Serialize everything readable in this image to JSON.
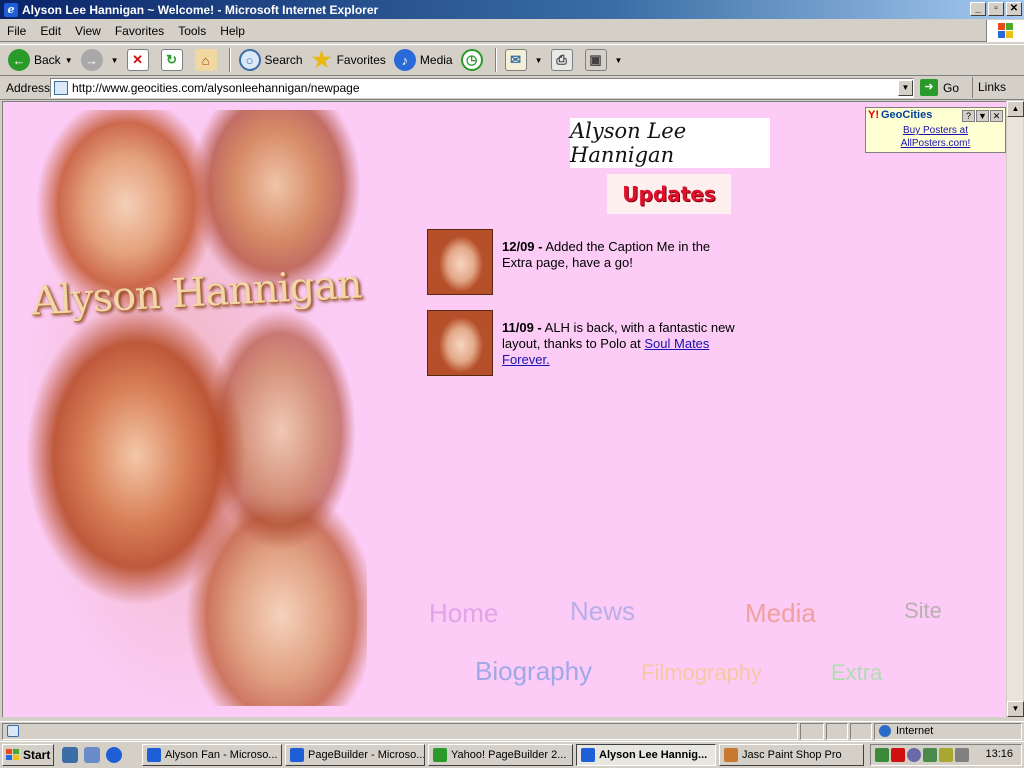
{
  "window": {
    "title": "Alyson Lee Hannigan ~ Welcome! - Microsoft Internet Explorer",
    "app_icon": "ie-icon"
  },
  "menu": [
    "File",
    "Edit",
    "View",
    "Favorites",
    "Tools",
    "Help"
  ],
  "toolbar": {
    "back": "Back",
    "search": "Search",
    "favorites": "Favorites",
    "media": "Media"
  },
  "address": {
    "label": "Address",
    "url": "http://www.geocities.com/alysonleehannigan/newpage",
    "go": "Go",
    "links": "Links"
  },
  "page": {
    "collage_title": "Alyson Hannigan",
    "logo_text": "Alyson Lee Hannigan",
    "updates_heading": "Updates",
    "updates": [
      {
        "date": "12/09 -",
        "text": " Added the Caption Me in the Extra page, have a go!",
        "link": ""
      },
      {
        "date": "11/09 -",
        "text": " ALH is back, with a fantastic new layout, thanks to Polo at ",
        "link": "Soul Mates Forever."
      }
    ],
    "nav": {
      "home": "Home",
      "news": "News",
      "media": "Media",
      "site": "Site",
      "biography": "Biography",
      "filmography": "Filmography",
      "extra": "Extra"
    },
    "geocities": {
      "brand_y": "Y!",
      "brand": "GeoCities",
      "link_line1": "Buy Posters at",
      "link_line2": "AllPosters.com!"
    }
  },
  "status": {
    "zone": "Internet"
  },
  "taskbar": {
    "start": "Start",
    "tasks": [
      {
        "label": "Alyson Fan - Microso...",
        "active": false
      },
      {
        "label": "PageBuilder - Microso...",
        "active": false
      },
      {
        "label": "Yahoo! PageBuilder 2...",
        "active": false
      },
      {
        "label": "Alyson Lee Hannig...",
        "active": true
      },
      {
        "label": "Jasc Paint Shop Pro",
        "active": false
      }
    ],
    "clock": "13:16"
  },
  "colors": {
    "page_background": "#fcccf6",
    "titlebar_start": "#0a246a",
    "link": "#1a12b0",
    "updates_red": "#e0102a"
  }
}
